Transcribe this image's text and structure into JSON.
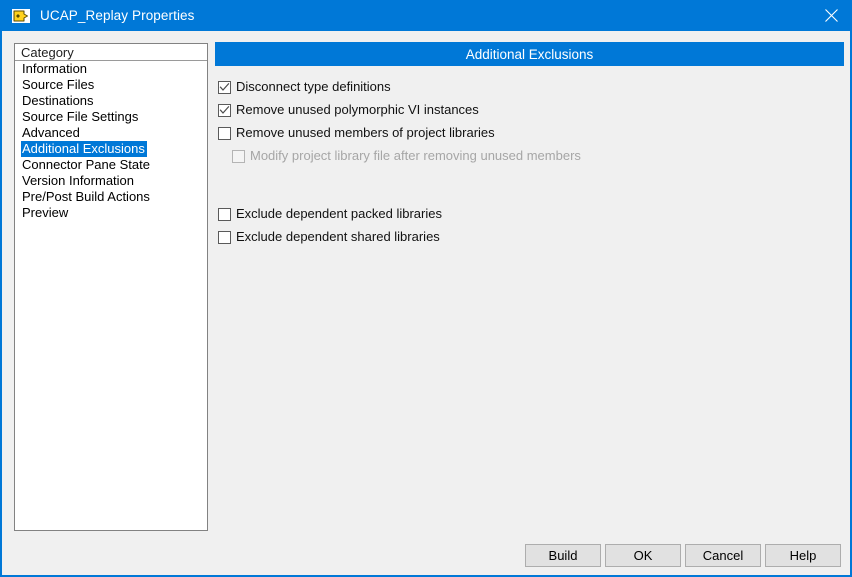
{
  "window": {
    "title": "UCAP_Replay Properties",
    "icon": "labview-vi-icon",
    "close_icon": "close-icon",
    "accent_color": "#0078d7",
    "background_color": "#f0f0f0"
  },
  "category_list": {
    "header": "Category",
    "items": [
      {
        "label": "Information",
        "selected": false
      },
      {
        "label": "Source Files",
        "selected": false
      },
      {
        "label": "Destinations",
        "selected": false
      },
      {
        "label": "Source File Settings",
        "selected": false
      },
      {
        "label": "Advanced",
        "selected": false
      },
      {
        "label": "Additional Exclusions",
        "selected": true
      },
      {
        "label": "Connector Pane State",
        "selected": false
      },
      {
        "label": "Version Information",
        "selected": false
      },
      {
        "label": "Pre/Post Build Actions",
        "selected": false
      },
      {
        "label": "Preview",
        "selected": false
      }
    ],
    "selected_label": "Additional Exclusions",
    "selection_color": "#0078d7"
  },
  "panel": {
    "banner_title": "Additional Exclusions",
    "options": [
      {
        "label": "Disconnect type definitions",
        "checked": true,
        "disabled": false,
        "indented": false,
        "name": "disconnect-type-definitions"
      },
      {
        "label": "Remove unused polymorphic VI instances",
        "checked": true,
        "disabled": false,
        "indented": false,
        "name": "remove-unused-polymorphic-vi-instances"
      },
      {
        "label": "Remove unused members of project libraries",
        "checked": false,
        "disabled": false,
        "indented": false,
        "name": "remove-unused-members-of-project-libraries"
      },
      {
        "label": "Modify project library file after removing unused members",
        "checked": false,
        "disabled": true,
        "indented": true,
        "name": "modify-project-library-file"
      },
      {
        "label": "Exclude dependent packed libraries",
        "checked": false,
        "disabled": false,
        "indented": false,
        "name": "exclude-dependent-packed-libraries",
        "gap_before": true
      },
      {
        "label": "Exclude dependent shared libraries",
        "checked": false,
        "disabled": false,
        "indented": false,
        "name": "exclude-dependent-shared-libraries"
      }
    ]
  },
  "footer": {
    "buttons": [
      {
        "label": "Build",
        "name": "build-button"
      },
      {
        "label": "OK",
        "name": "ok-button"
      },
      {
        "label": "Cancel",
        "name": "cancel-button"
      },
      {
        "label": "Help",
        "name": "help-button"
      }
    ]
  }
}
